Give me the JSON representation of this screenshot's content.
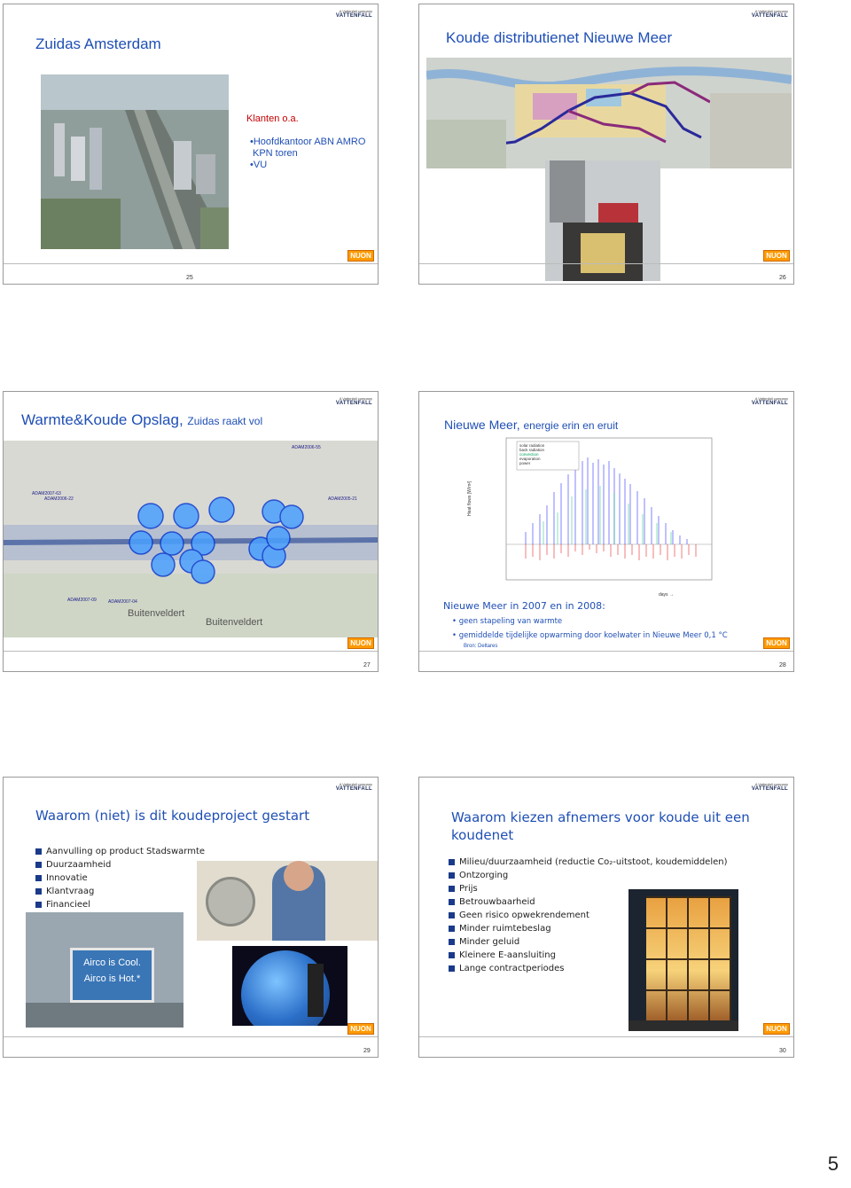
{
  "company_logo": {
    "tagline": "A Vattenfall company",
    "brand": "VATTENFALL",
    "nuon": "NUON"
  },
  "slides": [
    {
      "title": "Zuidas Amsterdam",
      "page": "25",
      "klanten": {
        "heading": "Klanten o.a.",
        "items": [
          "•Hoofdkantoor ABN AMRO",
          "KPN toren",
          "•VU"
        ]
      }
    },
    {
      "title": "Koude distributienet Nieuwe Meer",
      "page": "26"
    },
    {
      "title": "Warmte&Koude Opslag,",
      "subtitle": "Zuidas raakt vol",
      "page": "27",
      "map_labels": [
        "ADAM2006-55",
        "ADAM2007-63",
        "ADAM2006-22",
        "ADAM2005-21",
        "ADAM2007-04",
        "ADAM2007-09",
        "Buitenveldert",
        "Buitenveldert"
      ]
    },
    {
      "title": "Nieuwe Meer,",
      "subtitle": "energie erin en eruit",
      "page": "28",
      "chart": {
        "ylabel": "Heat flows [W/m²]",
        "xlabel": "days →",
        "legend": [
          "solar radiation",
          "back radiation",
          "convection",
          "evaporation",
          "power"
        ],
        "yticks": [
          "1000",
          "900",
          "800",
          "700",
          "600",
          "500",
          "400",
          "300",
          "200",
          "100",
          "0",
          "-100",
          "-200",
          "-300"
        ],
        "xticks": [
          "0",
          "30",
          "60",
          "90",
          "120",
          "150",
          "180",
          "210",
          "240",
          "270",
          "300",
          "330",
          "360"
        ]
      },
      "heading": "Nieuwe Meer in 2007 en in 2008:",
      "points": [
        "geen stapeling van warmte",
        "gemiddelde tijdelijke opwarming door koelwater in Nieuwe Meer 0,1 °C"
      ],
      "source": "Bron: Deltares"
    },
    {
      "title": "Waarom (niet) is dit koudeproject gestart",
      "page": "29",
      "items": [
        "Aanvulling op product Stadswarmte",
        "Duurzaamheid",
        "Innovatie",
        "Klantvraag",
        "Financieel"
      ],
      "billboard": [
        "Airco is Cool.",
        "Airco is Hot.*"
      ]
    },
    {
      "title": "Waarom kiezen afnemers voor koude uit een koudenet",
      "page": "30",
      "items": [
        "Milieu/duurzaamheid (reductie Co₂-uitstoot, koudemiddelen)",
        "Ontzorging",
        "Prijs",
        "Betrouwbaarheid",
        "Geen risico opwekrendement",
        "Minder ruimtebeslag",
        "Minder geluid",
        "Kleinere E-aansluiting",
        "Lange contractperiodes"
      ]
    }
  ],
  "page_number": "5"
}
